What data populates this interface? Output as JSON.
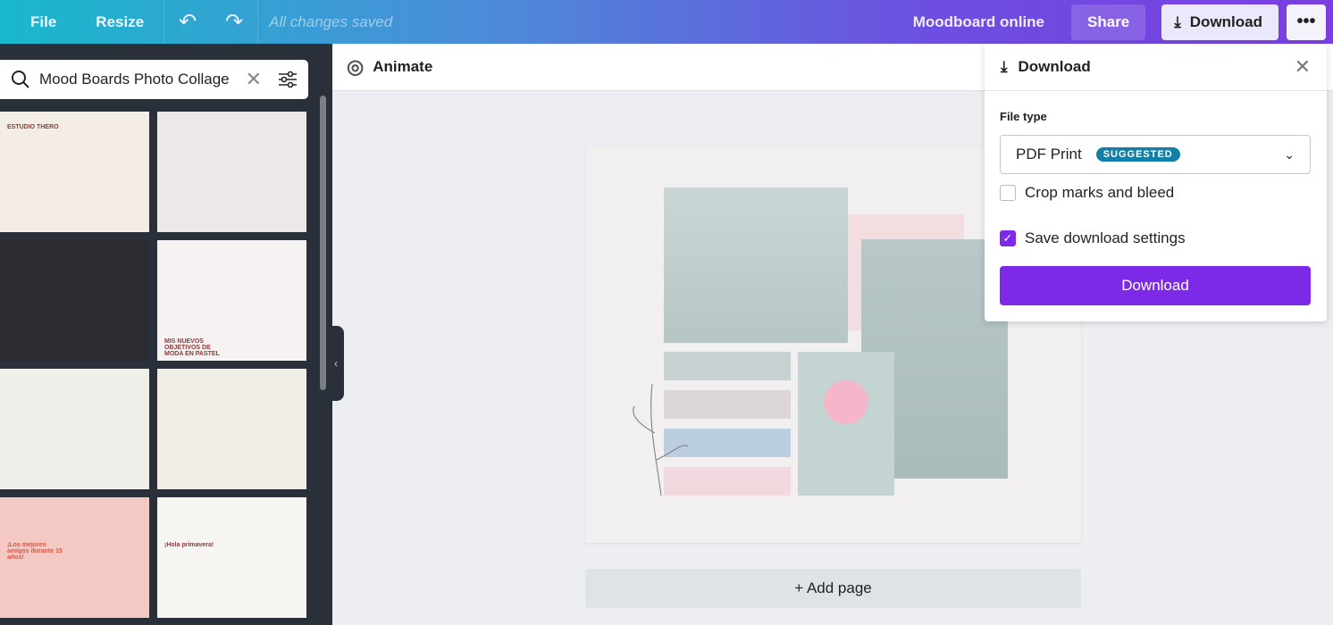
{
  "topbar": {
    "file": "File",
    "resize": "Resize",
    "undo_icon": "undo-icon",
    "redo_icon": "redo-icon",
    "status": "All changes saved",
    "title": "Moodboard online",
    "share": "Share",
    "download": "Download",
    "more": "•••"
  },
  "sidebar": {
    "search_value": "Mood Boards Photo Collage",
    "templates": [
      {
        "text": "ESTUDIO THERO",
        "bg": "#f3ede6"
      },
      {
        "text": "",
        "bg": "#ece8ea"
      },
      {
        "text": "",
        "bg": "#2a2c30"
      },
      {
        "text": "MIS NUEVOS OBJETIVOS DE MODA EN PASTEL",
        "bg": "#f6f2f2"
      },
      {
        "text": "",
        "bg": "#f1efe9"
      },
      {
        "text": "",
        "bg": "#efede6"
      },
      {
        "text": "¡Los mejores amigos durante 15 años!",
        "bg": "#f4c9c4"
      },
      {
        "text": "¡Hola primavera!",
        "bg": "#f7f5f2"
      }
    ]
  },
  "toolbar": {
    "animate": "Animate"
  },
  "canvas": {
    "add_page": "+ Add page"
  },
  "download_panel": {
    "title": "Download",
    "file_type_label": "File type",
    "file_type_value": "PDF Print",
    "badge": "SUGGESTED",
    "crop_marks": "Crop marks and bleed",
    "crop_checked": false,
    "save_settings": "Save download settings",
    "save_checked": true,
    "download_button": "Download"
  },
  "colors": {
    "accent": "#7d2ae8",
    "badge": "#127fa6",
    "sidebar": "#293039"
  }
}
